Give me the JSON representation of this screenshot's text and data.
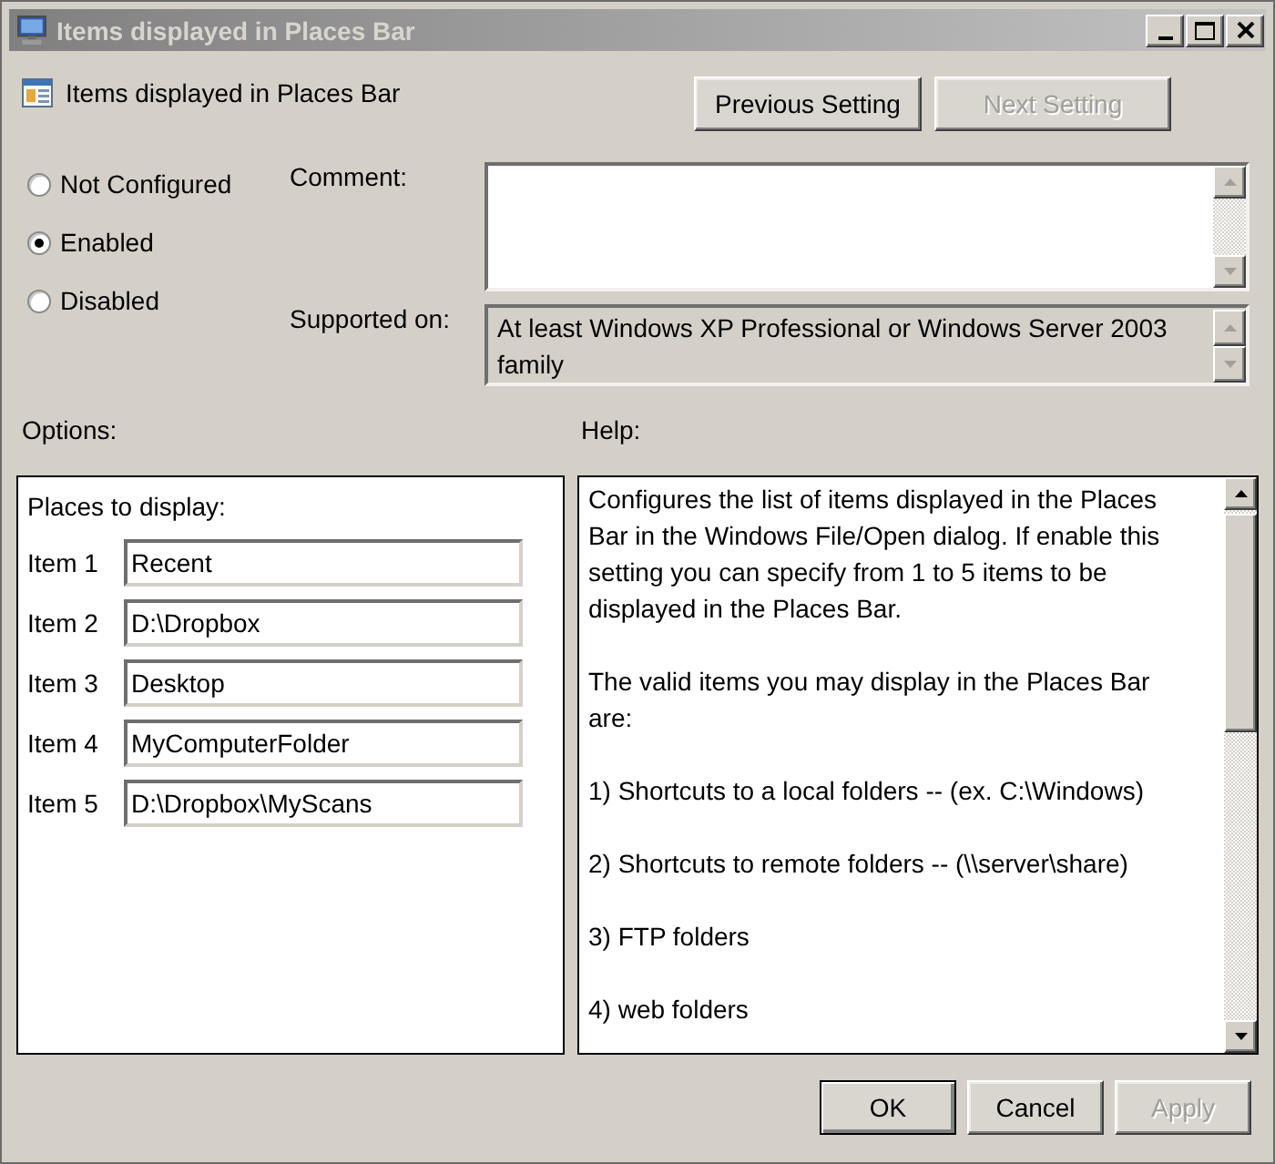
{
  "window": {
    "title": "Items displayed in Places Bar"
  },
  "header": {
    "title": "Items displayed in Places Bar",
    "buttons": [
      {
        "label": "Previous Setting",
        "disabled": false
      },
      {
        "label": "Next Setting",
        "disabled": true
      }
    ]
  },
  "state_options": [
    {
      "label": "Not Configured",
      "selected": false
    },
    {
      "label": "Enabled",
      "selected": true
    },
    {
      "label": "Disabled",
      "selected": false
    }
  ],
  "comment": {
    "label": "Comment:"
  },
  "supported_on": {
    "label": "Supported on:",
    "value": "At least Windows XP Professional or Windows Server 2003 family"
  },
  "options": {
    "label": "Options:",
    "heading": "Places to display:",
    "items": [
      {
        "label": "Item 1",
        "value": "Recent"
      },
      {
        "label": "Item 2",
        "value": "D:\\Dropbox"
      },
      {
        "label": "Item 3",
        "value": "Desktop"
      },
      {
        "label": "Item 4",
        "value": "MyComputerFolder"
      },
      {
        "label": "Item 5",
        "value": "D:\\Dropbox\\MyScans"
      }
    ]
  },
  "help": {
    "label": "Help:",
    "paragraphs": [
      "Configures the list of items displayed in the Places Bar in the Windows File/Open dialog. If enable this setting you can specify from 1 to 5 items to be displayed in the Places Bar.",
      "The valid items you may display in the Places Bar are:",
      "1) Shortcuts to a local folders -- (ex. C:\\Windows)",
      "2) Shortcuts to remote folders -- (\\\\server\\share)",
      "3) FTP folders",
      "4) web folders"
    ]
  },
  "footer_buttons": [
    {
      "label": "OK",
      "disabled": false,
      "default": true
    },
    {
      "label": "Cancel",
      "disabled": false,
      "default": false
    },
    {
      "label": "Apply",
      "disabled": true,
      "default": false
    }
  ]
}
